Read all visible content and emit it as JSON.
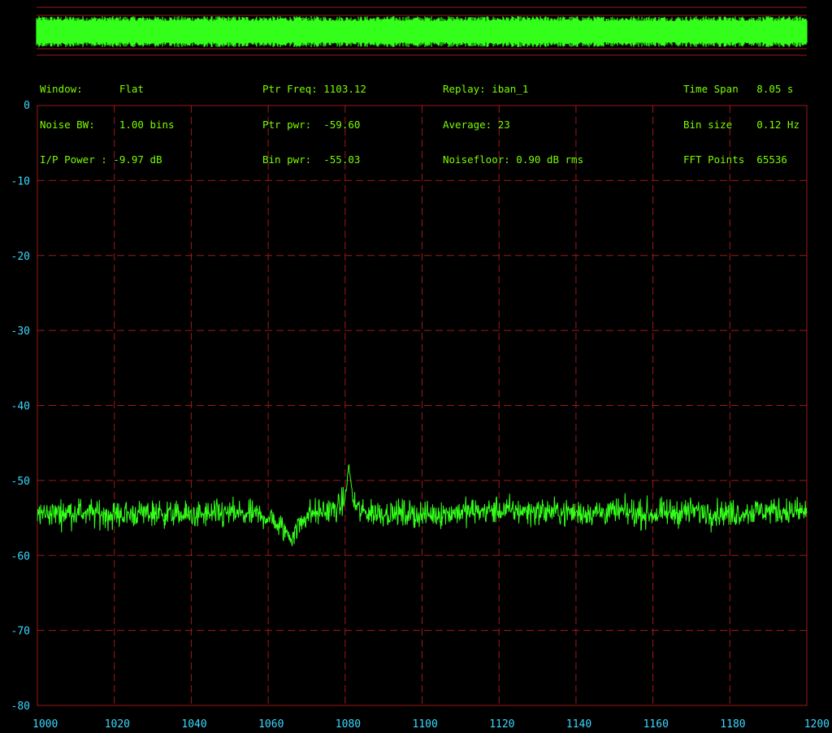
{
  "colors": {
    "background": "#000000",
    "trace": "#33ff1a",
    "grid": "#a01818",
    "axis_label": "#3ad8ff",
    "info_text": "#7CFC00"
  },
  "info": {
    "col1": [
      "Window:      Flat",
      "Noise BW:    1.00 bins",
      "I/P Power : -9.97 dB"
    ],
    "col2": [
      "Ptr Freq: 1103.12",
      "Ptr pwr:  -59.60",
      "Bin pwr:  -55.03"
    ],
    "col3": [
      "Replay: iban_1",
      "Average: 23",
      "Noisefloor: 0.90 dB rms"
    ],
    "col4": [
      "Time Span   8.05 s",
      "Bin size    0.12 Hz",
      "FFT Points  65536"
    ]
  },
  "chart_data": {
    "type": "line",
    "title": "",
    "xlabel": "",
    "ylabel": "",
    "xlim": [
      1000,
      1200
    ],
    "ylim": [
      -80,
      0
    ],
    "x_ticks": [
      "1000",
      "1020",
      "1040",
      "1060",
      "1080",
      "1100",
      "1120",
      "1140",
      "1160",
      "1180",
      "1200"
    ],
    "y_ticks": [
      "0",
      "-10",
      "-20",
      "-30",
      "-40",
      "-50",
      "-60",
      "-70",
      "-80"
    ],
    "grid": true,
    "series": [
      {
        "noise_floor_db": -54.5,
        "noise_rms_db": 0.9,
        "points": [
          {
            "x": 1000,
            "y": -54.5
          },
          {
            "x": 1010,
            "y": -54.2
          },
          {
            "x": 1020,
            "y": -54.6
          },
          {
            "x": 1030,
            "y": -54.3
          },
          {
            "x": 1040,
            "y": -54.7
          },
          {
            "x": 1050,
            "y": -54.4
          },
          {
            "x": 1060,
            "y": -54.8
          },
          {
            "x": 1066,
            "y": -57.5
          },
          {
            "x": 1070,
            "y": -54.5
          },
          {
            "x": 1078,
            "y": -53.8
          },
          {
            "x": 1080,
            "y": -52.5
          },
          {
            "x": 1081,
            "y": -47.8
          },
          {
            "x": 1082,
            "y": -52.8
          },
          {
            "x": 1084,
            "y": -54.2
          },
          {
            "x": 1090,
            "y": -54.3
          },
          {
            "x": 1100,
            "y": -54.6
          },
          {
            "x": 1110,
            "y": -54.2
          },
          {
            "x": 1120,
            "y": -54.0
          },
          {
            "x": 1130,
            "y": -54.1
          },
          {
            "x": 1140,
            "y": -54.3
          },
          {
            "x": 1150,
            "y": -54.2
          },
          {
            "x": 1160,
            "y": -54.5
          },
          {
            "x": 1170,
            "y": -54.1
          },
          {
            "x": 1180,
            "y": -54.4
          },
          {
            "x": 1190,
            "y": -54.0
          },
          {
            "x": 1200,
            "y": -54.2
          }
        ]
      }
    ]
  }
}
